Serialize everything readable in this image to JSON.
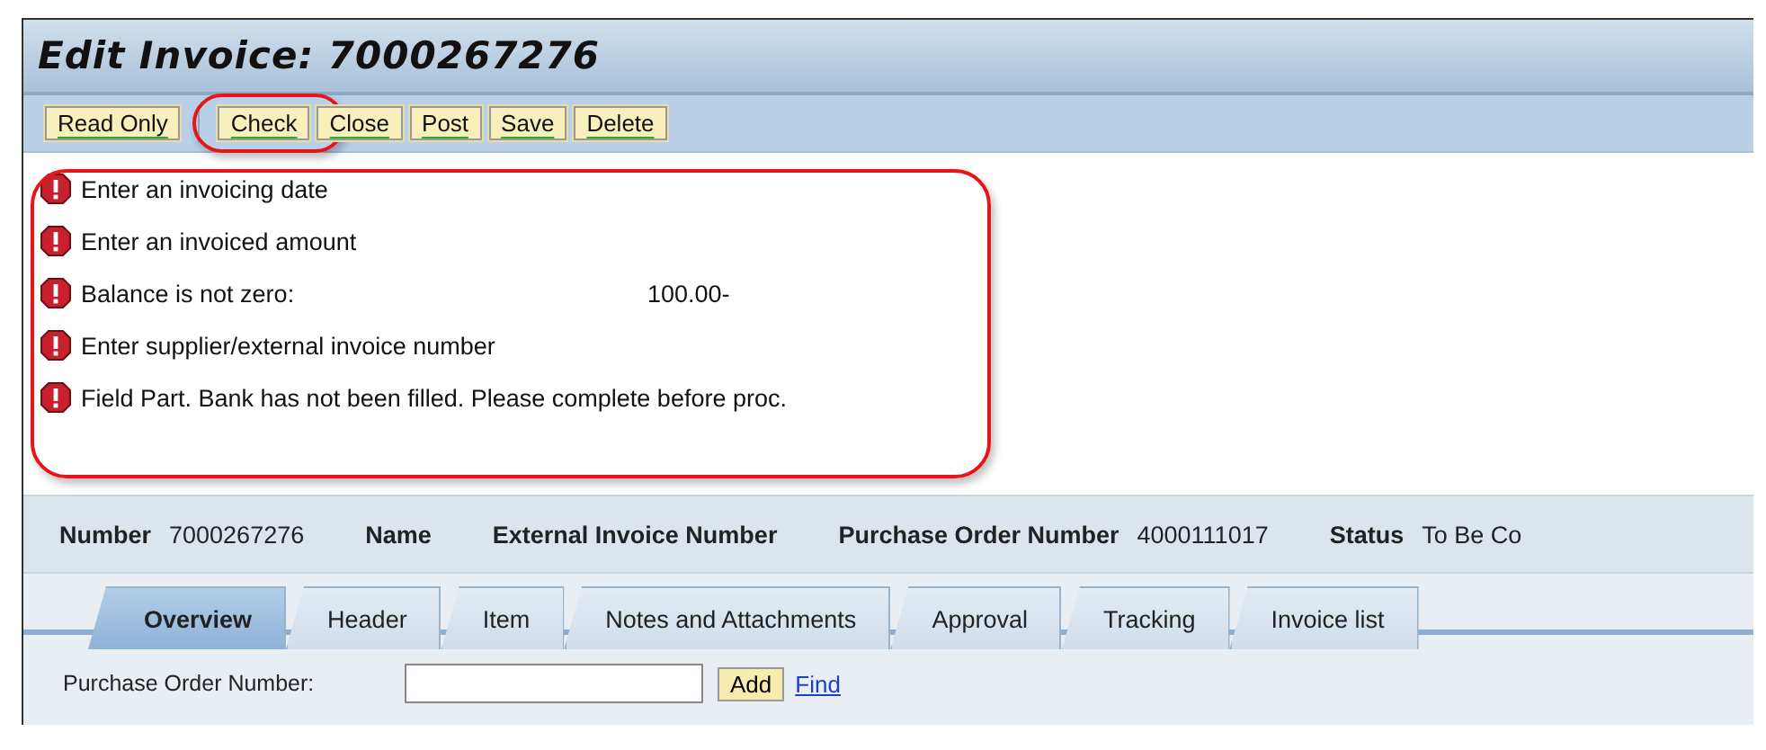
{
  "window": {
    "title": "Edit Invoice: 7000267276"
  },
  "toolbar": [
    {
      "label": "Read Only",
      "highlighted": false
    },
    {
      "label": "Check",
      "highlighted": true
    },
    {
      "label": "Close",
      "highlighted": false
    },
    {
      "label": "Post",
      "highlighted": false
    },
    {
      "label": "Save",
      "highlighted": false
    },
    {
      "label": "Delete",
      "highlighted": false
    }
  ],
  "messages": {
    "highlighted": true,
    "items": [
      {
        "text": "Enter an invoicing date"
      },
      {
        "text": "Enter an invoiced amount"
      },
      {
        "text": "Balance is not zero:",
        "value": "100.00-"
      },
      {
        "text": "Enter supplier/external invoice number"
      },
      {
        "text": "Field Part. Bank has not been filled. Please complete before proc."
      }
    ]
  },
  "header_fields": [
    {
      "label": "Number",
      "value": "7000267276"
    },
    {
      "label": "Name"
    },
    {
      "label": "External Invoice Number"
    },
    {
      "label": "Purchase Order Number",
      "value": "4000111017"
    },
    {
      "label": "Status",
      "value": "To Be Co"
    }
  ],
  "tabs": [
    {
      "label": "Overview",
      "selected": true
    },
    {
      "label": "Header",
      "selected": false
    },
    {
      "label": "Item",
      "selected": false
    },
    {
      "label": "Notes and Attachments",
      "selected": false
    },
    {
      "label": "Approval",
      "selected": false
    },
    {
      "label": "Tracking",
      "selected": false
    },
    {
      "label": "Invoice list",
      "selected": false
    }
  ],
  "form": {
    "label": "Purchase Order Number:",
    "add_button": "Add",
    "find_link": "Find"
  }
}
